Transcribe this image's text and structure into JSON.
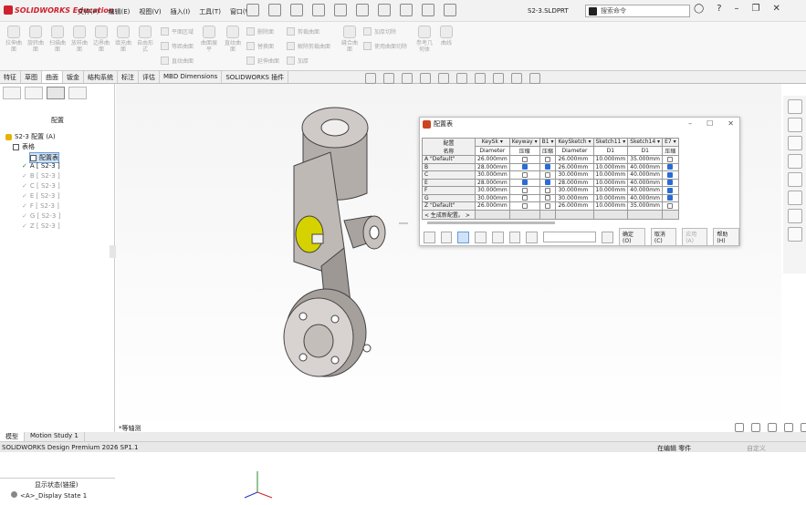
{
  "app": {
    "brand": "SOLIDWORKS Education",
    "doc_title": "S2-3.SLDPRT",
    "status_text": "SOLIDWORKS Design Premium 2026 SP1.1",
    "status_mode": "在编辑 零件",
    "status_units": "自定义"
  },
  "menu": [
    "文件(F)",
    "编辑(E)",
    "视图(V)",
    "插入(I)",
    "工具(T)",
    "窗口(W)"
  ],
  "search": {
    "placeholder": "搜索命令"
  },
  "ribbon": {
    "buttons": [
      "拉伸曲面",
      "旋转曲面",
      "扫描曲面",
      "放样曲面",
      "边界曲面",
      "填充曲面",
      "自由形式",
      "曲面展平",
      "直纹曲面",
      "缝合曲面",
      "参考几何体",
      "曲线"
    ],
    "small": [
      "平面区域",
      "等距曲面",
      "直纹曲面",
      "删除面",
      "替换面",
      "延伸曲面",
      "剪裁曲面",
      "解除剪裁曲面",
      "加厚",
      "加厚切除",
      "使用曲面切除"
    ]
  },
  "tabs": [
    "特征",
    "草图",
    "曲面",
    "钣金",
    "结构系统",
    "标注",
    "评估",
    "MBD Dimensions",
    "SOLIDWORKS 插件"
  ],
  "active_tab": "曲面",
  "panel": {
    "title": "配置",
    "tree": [
      {
        "label": "S2-3 配置  (A)"
      },
      {
        "label": "表格"
      },
      {
        "label": "配置表"
      },
      {
        "label": "A [ S2-3 ]"
      },
      {
        "label": "B [ S2-3 ]"
      },
      {
        "label": "C [ S2-3 ]"
      },
      {
        "label": "E [ S2-3 ]"
      },
      {
        "label": "F [ S2-3 ]"
      },
      {
        "label": "G [ S2-3 ]"
      },
      {
        "label": "Z [ S2-3 ]"
      }
    ],
    "display_title": "显示状态(链接)",
    "display_state": "<A>_Display State 1"
  },
  "dialog": {
    "title": "配置表",
    "header_name": "配置",
    "header_name2": "名称",
    "columns": [
      "KeySk",
      "Keyway",
      "B1",
      "KeySketch",
      "Sketch11",
      "Sketch14",
      "E7"
    ],
    "subheaders": [
      "Diameter",
      "压缩",
      "压缩",
      "Diameter",
      "D1",
      "D1",
      "压缩"
    ],
    "rows": [
      {
        "name": "A \"Default\"",
        "v": [
          "26.000mm",
          "0",
          "0",
          "26.000mm",
          "10.000mm",
          "35.000mm",
          "0"
        ]
      },
      {
        "name": "B",
        "v": [
          "28.000mm",
          "1",
          "1",
          "26.000mm",
          "10.000mm",
          "40.000mm",
          "1"
        ]
      },
      {
        "name": "C",
        "v": [
          "30.000mm",
          "0",
          "0",
          "30.000mm",
          "10.000mm",
          "40.000mm",
          "1"
        ]
      },
      {
        "name": "E",
        "v": [
          "28.000mm",
          "1",
          "1",
          "28.000mm",
          "10.000mm",
          "40.000mm",
          "1"
        ]
      },
      {
        "name": "F",
        "v": [
          "30.000mm",
          "0",
          "0",
          "30.000mm",
          "10.000mm",
          "40.000mm",
          "1"
        ]
      },
      {
        "name": "G",
        "v": [
          "30.000mm",
          "0",
          "0",
          "30.000mm",
          "10.000mm",
          "40.000mm",
          "1"
        ]
      },
      {
        "name": "Z \"Default\"",
        "v": [
          "26.000mm",
          "0",
          "0",
          "26.000mm",
          "10.000mm",
          "35.000mm",
          "0"
        ]
      }
    ],
    "new_row": "< 生成新配置。 >",
    "buttons": {
      "ok": "确定(O)",
      "cancel": "取消(C)",
      "apply": "应用(A)",
      "help": "帮助(H)"
    }
  },
  "canvas": {
    "view_label": "*等轴测"
  },
  "bottom_tabs": [
    "模型",
    "Motion Study 1"
  ]
}
